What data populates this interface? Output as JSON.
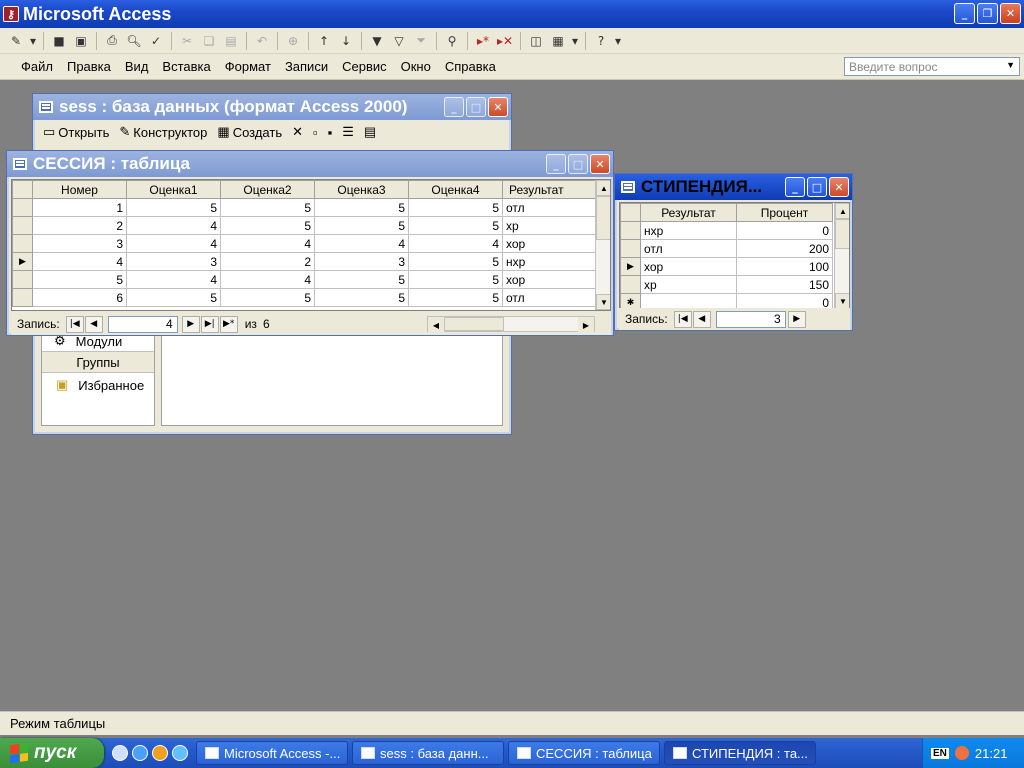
{
  "app": {
    "title": "Microsoft Access"
  },
  "toolbar": {
    "icons": [
      "design-view-icon",
      "dropdown-arrow-icon",
      "save-icon",
      "print-preview-icon",
      "print-icon",
      "preview-icon",
      "spelling-icon",
      "cut-icon",
      "copy-icon",
      "paste-icon",
      "undo-icon",
      "hyperlink-icon",
      "sort-ascending-icon",
      "sort-descending-icon",
      "filter-by-selection-icon",
      "filter-by-form-icon",
      "apply-filter-icon",
      "find-icon",
      "new-record-icon",
      "delete-record-icon",
      "database-window-icon",
      "new-object-icon",
      "help-icon"
    ]
  },
  "menu": {
    "items": [
      "Файл",
      "Правка",
      "Вид",
      "Вставка",
      "Формат",
      "Записи",
      "Сервис",
      "Окно",
      "Справка"
    ],
    "ask_placeholder": "Введите вопрос"
  },
  "db_window": {
    "title": "sess : база данных (формат Access 2000)",
    "toolbar": {
      "open": "Открыть",
      "design": "Конструктор",
      "create": "Создать"
    },
    "objects": {
      "modules": "Модули",
      "groups_header": "Группы",
      "favorites": "Избранное"
    }
  },
  "session_table": {
    "title": "СЕССИЯ : таблица",
    "columns": [
      "Номер",
      "Оценка1",
      "Оценка2",
      "Оценка3",
      "Оценка4",
      "Результат"
    ],
    "rows": [
      [
        "1",
        "5",
        "5",
        "5",
        "5",
        "отл"
      ],
      [
        "2",
        "4",
        "5",
        "5",
        "5",
        "хр"
      ],
      [
        "3",
        "4",
        "4",
        "4",
        "4",
        "хор"
      ],
      [
        "4",
        "3",
        "2",
        "3",
        "5",
        "нхр"
      ],
      [
        "5",
        "4",
        "4",
        "5",
        "5",
        "хор"
      ],
      [
        "6",
        "5",
        "5",
        "5",
        "5",
        "отл"
      ]
    ],
    "nav": {
      "label": "Запись:",
      "current": "4",
      "of_label": "из",
      "total": "6"
    }
  },
  "stipend_table": {
    "title": "СТИПЕНДИЯ...",
    "columns": [
      "Результат",
      "Процент"
    ],
    "rows": [
      [
        "нхр",
        "0"
      ],
      [
        "отл",
        "200"
      ],
      [
        "хор",
        "100"
      ],
      [
        "хр",
        "150"
      ]
    ],
    "new_row_value": "0",
    "nav": {
      "label": "Запись:",
      "current": "3"
    }
  },
  "statusbar": {
    "text": "Режим таблицы"
  },
  "taskbar": {
    "start": "пуск",
    "tasks": [
      "Microsoft Access -...",
      "sess : база данн...",
      "СЕССИЯ : таблица",
      "СТИПЕНДИЯ : та..."
    ],
    "lang": "EN",
    "clock": "21:21"
  }
}
